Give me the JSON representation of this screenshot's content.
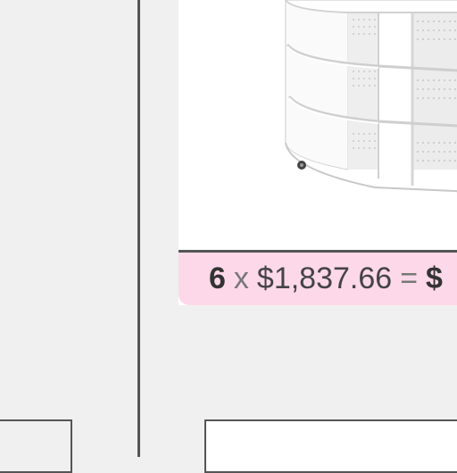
{
  "order_line": {
    "quantity": "6",
    "multiply_sign": "x",
    "unit_price": "$1,837.66",
    "equals_sign": "=",
    "total_visible": "$"
  },
  "product": {
    "image_icon": "curved-bookcase-shelf-unit"
  },
  "colors": {
    "price_bar_bg": "#fdd8e8",
    "divider": "#555555",
    "page_bg": "#f0f0f0"
  }
}
